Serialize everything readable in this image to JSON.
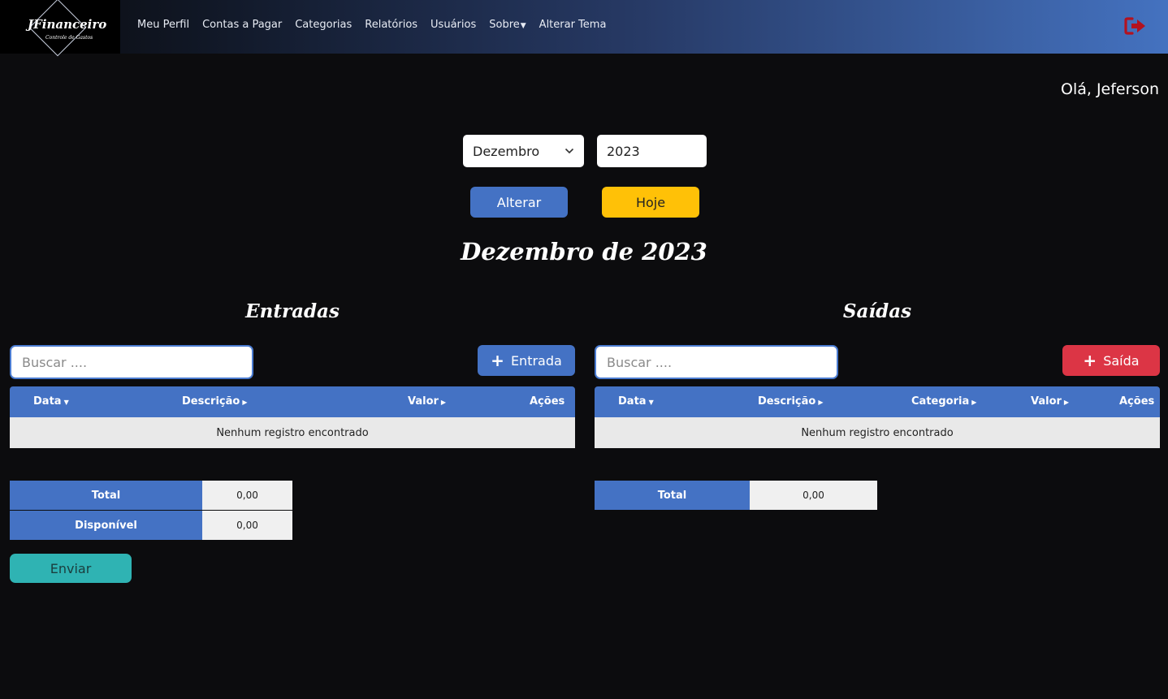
{
  "brand": {
    "name": "JFinanceiro",
    "tagline": "Controle de Gastos"
  },
  "nav": {
    "items": [
      {
        "label": "Meu Perfil"
      },
      {
        "label": "Contas a Pagar"
      },
      {
        "label": "Categorias"
      },
      {
        "label": "Relatórios"
      },
      {
        "label": "Usuários"
      },
      {
        "label": "Sobre",
        "dropdown": true
      },
      {
        "label": "Alterar Tema"
      }
    ],
    "logout_icon": "sign-out-icon"
  },
  "greeting": "Olá, Jeferson",
  "filter": {
    "month": "Dezembro",
    "year": "2023",
    "alterar_label": "Alterar",
    "hoje_label": "Hoje"
  },
  "period_title": "Dezembro de 2023",
  "entradas": {
    "title": "Entradas",
    "search_placeholder": "Buscar ....",
    "add_label": "Entrada",
    "columns": {
      "data": "Data",
      "descricao": "Descrição",
      "valor": "Valor",
      "acoes": "Ações"
    },
    "empty_message": "Nenhum registro encontrado",
    "total_label": "Total",
    "total_value": "0,00",
    "disponivel_label": "Disponível",
    "disponivel_value": "0,00",
    "enviar_label": "Enviar"
  },
  "saidas": {
    "title": "Saídas",
    "search_placeholder": "Buscar ....",
    "add_label": "Saída",
    "columns": {
      "data": "Data",
      "descricao": "Descrição",
      "categoria": "Categoria",
      "valor": "Valor",
      "acoes": "Ações"
    },
    "empty_message": "Nenhum registro encontrado",
    "total_label": "Total",
    "total_value": "0,00"
  },
  "colors": {
    "primary": "#4472c4",
    "warning": "#ffc107",
    "danger": "#dc3545",
    "teal": "#2fb3b3",
    "logout": "#b3121f"
  }
}
